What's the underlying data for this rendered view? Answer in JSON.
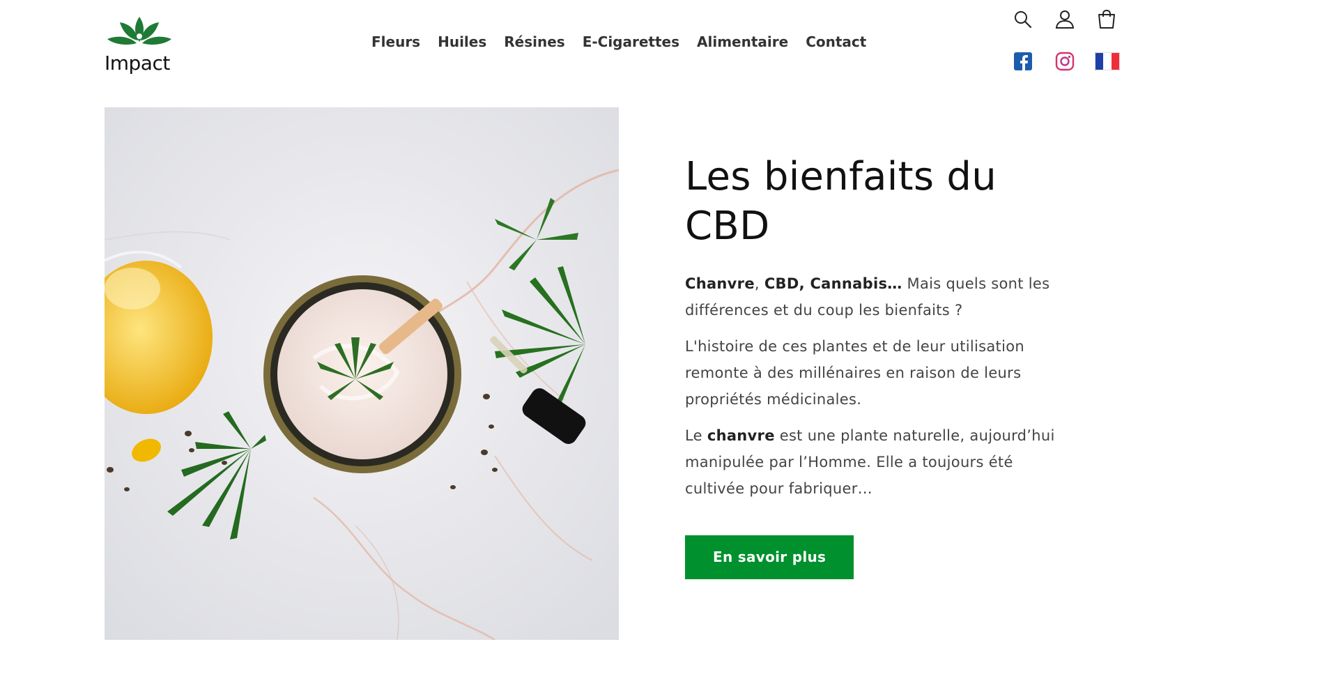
{
  "brand": {
    "logo_text": "Impact",
    "color": "#1f7a35"
  },
  "nav": {
    "items": [
      "Fleurs",
      "Huiles",
      "Résines",
      "E-Cigarettes",
      "Alimentaire",
      "Contact"
    ]
  },
  "header_icons": {
    "search": "search-icon",
    "account": "account-icon",
    "cart": "cart-icon",
    "facebook": "facebook-icon",
    "instagram": "instagram-icon",
    "language": "french-flag-icon"
  },
  "hero": {
    "title": "Les bienfaits du CBD",
    "p1": {
      "b1": "Chanvre",
      "sep": ", ",
      "b2": "CBD, Cannabis…",
      "rest": " Mais quels sont les différences et du coup les bienfaits ?"
    },
    "p2": "L'histoire de ces plantes et de leur utilisation remonte à des millénaires en raison de leurs propriétés médicinales.",
    "p3": {
      "pre": "Le ",
      "b": "chanvre",
      "rest": " est une plante naturelle, aujourd’hui manipulée par l’Homme. Elle a toujours été cultivée pour fabriquer…"
    },
    "cta_label": "En savoir plus"
  },
  "colors": {
    "accent": "#00902d",
    "facebook": "#1b5dab",
    "instagram": "#d6336c"
  }
}
